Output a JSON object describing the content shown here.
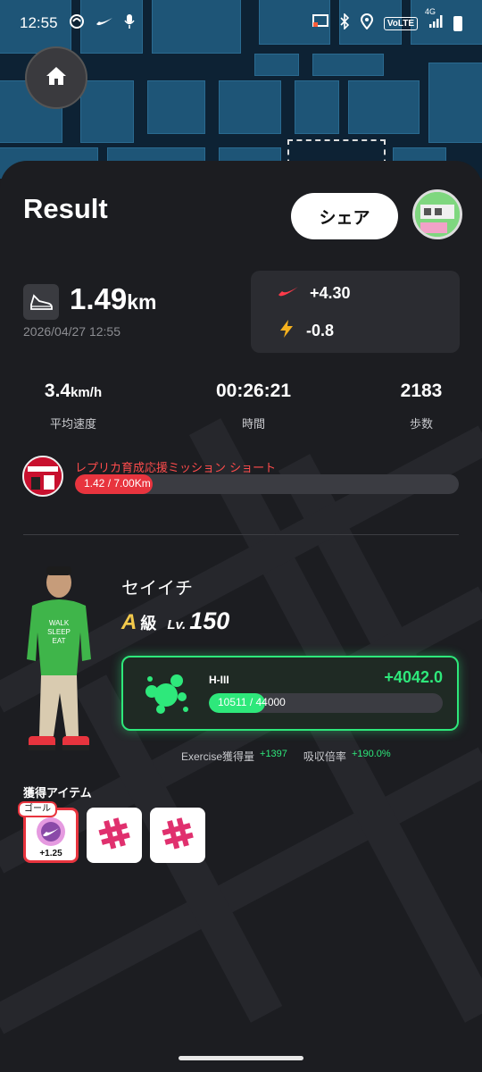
{
  "status_bar": {
    "time": "12:55",
    "left_icons": [
      "nfc-icon",
      "swoosh-icon",
      "mic-icon"
    ],
    "right_icons": [
      "cast-icon",
      "bluetooth-icon",
      "location-icon",
      "volte-icon",
      "signal-icon",
      "battery-icon"
    ],
    "network": "4G",
    "volte": "VoLTE"
  },
  "header": {
    "title": "Result",
    "share_label": "シェア"
  },
  "summary": {
    "distance_value": "1.49",
    "distance_unit": "km",
    "datetime": "2026/04/27 12:55",
    "swoosh_gain": "+4.30",
    "energy_change": "-0.8"
  },
  "stats": [
    {
      "value": "3.4",
      "unit": "km/h",
      "label": "平均速度"
    },
    {
      "value": "00:26:21",
      "unit": "",
      "label": "時間"
    },
    {
      "value": "2183",
      "unit": "",
      "label": "歩数"
    }
  ],
  "mission": {
    "title": "レプリカ育成応援ミッション ショート",
    "progress_text": "1.42 / 7.00Km",
    "progress_fraction": 0.203
  },
  "character": {
    "name": "セイイチ",
    "grade": "A",
    "grade_suffix": "級",
    "level_label": "Lv.",
    "level": "150"
  },
  "gene": {
    "name": "H-III",
    "gain": "+4042.0",
    "progress_text": "10511 / 44000",
    "progress_fraction": 0.239
  },
  "exercise": {
    "label": "Exercise獲得量",
    "value": "+1397",
    "absorb_label": "吸収倍率",
    "absorb_value": "+190.0%"
  },
  "items": {
    "title": "獲得アイテム",
    "goal_badge": "ゴール",
    "list": [
      {
        "icon": "swoosh-coin-icon",
        "count": "+1.25"
      },
      {
        "icon": "pink-hashtag-icon",
        "count": ""
      },
      {
        "icon": "pink-hashtag-icon",
        "count": ""
      }
    ]
  },
  "colors": {
    "accent_green": "#2ee87b",
    "accent_red": "#e8343e",
    "background": "#1c1d21"
  }
}
